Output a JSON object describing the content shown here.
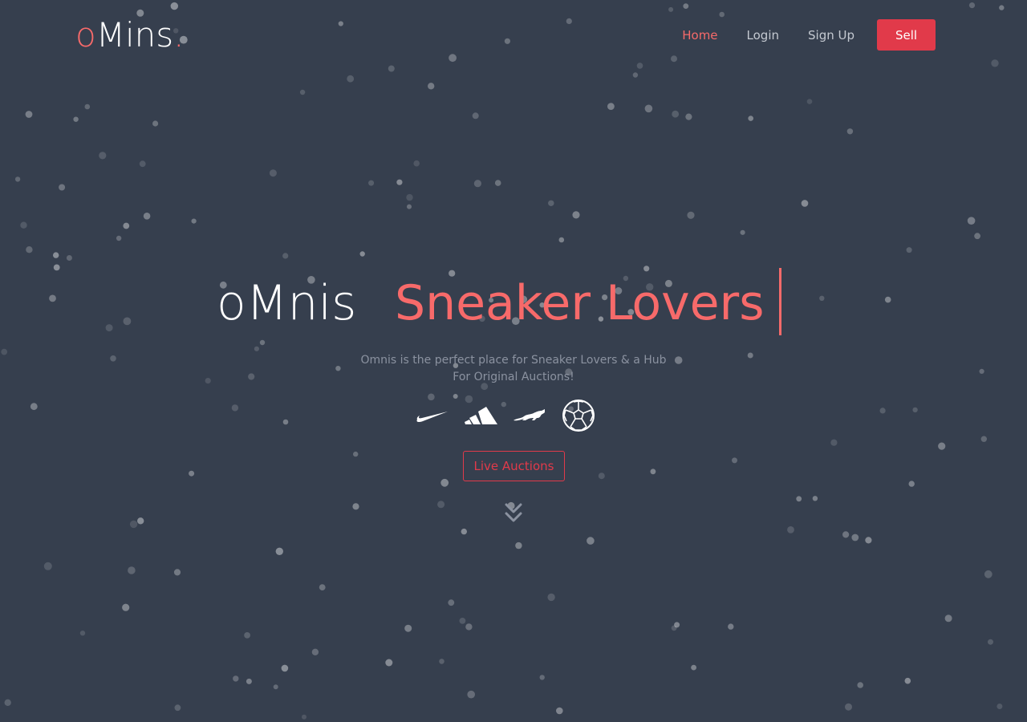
{
  "header": {
    "logo": {
      "prefix": "o",
      "main": "Mins",
      "suffix": "."
    },
    "nav": [
      {
        "label": "Home",
        "active": true
      },
      {
        "label": "Login",
        "active": false
      },
      {
        "label": "Sign Up",
        "active": false
      }
    ],
    "sell_label": "Sell"
  },
  "hero": {
    "brand": "oMnis",
    "tagline": "Sneaker Lovers",
    "description_line1": "Omnis is the perfect place for Sneaker Lovers & a Hub",
    "description_line2": "For Original Auctions!",
    "brand_icons": [
      "nike-icon",
      "adidas-icon",
      "puma-icon",
      "soccer-ball-icon"
    ],
    "cta_label": "Live Auctions",
    "scroll_icon": "chevrons-down-icon"
  },
  "colors": {
    "background": "#363f4e",
    "accent": "#f76a6a",
    "button": "#e13a4a",
    "nav_text": "#c4c9d1",
    "muted_text": "#8b92a0"
  }
}
